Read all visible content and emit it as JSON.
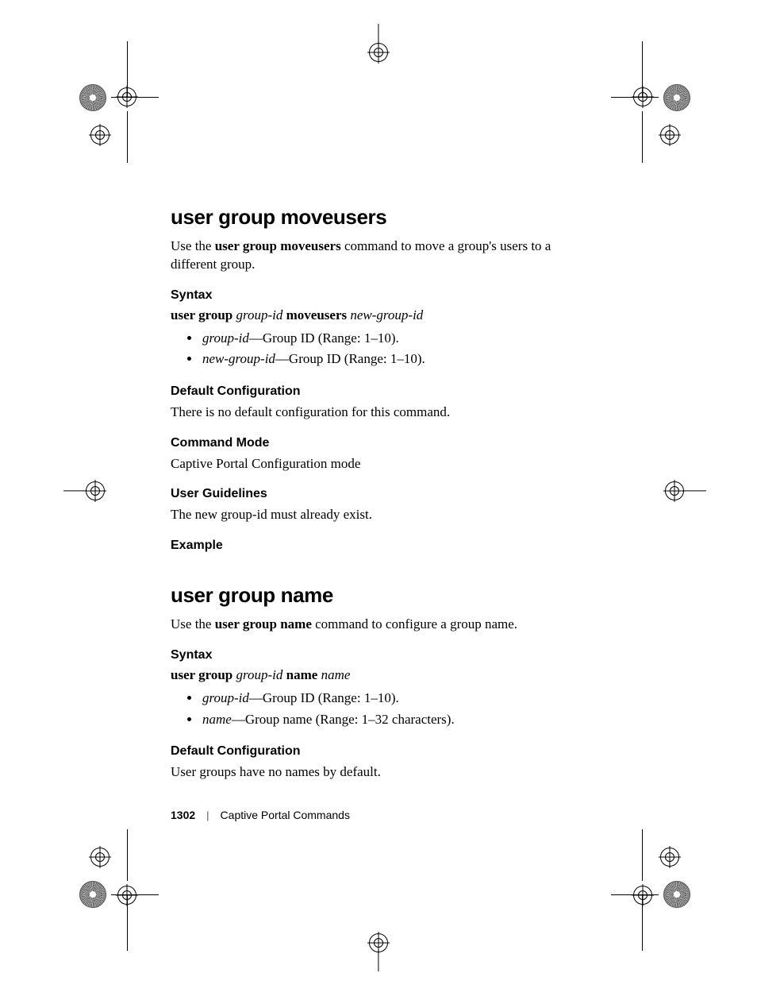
{
  "section1": {
    "title": "user group moveusers",
    "intro_pre": "Use the ",
    "intro_bold": "user group moveusers",
    "intro_post": " command to move a group's users to a different group.",
    "syntax_heading": "Syntax",
    "syntax_parts": {
      "p1": "user group ",
      "p2": "group-id",
      "p3": " moveusers ",
      "p4": "new-group-id"
    },
    "params": [
      {
        "name": "group-id",
        "desc": "—Group ID (Range: 1–10)."
      },
      {
        "name": "new-group-id",
        "desc": "—Group ID (Range: 1–10)."
      }
    ],
    "default_heading": "Default Configuration",
    "default_text": "There is no default configuration for this command.",
    "mode_heading": "Command Mode",
    "mode_text": "Captive Portal Configuration mode",
    "guidelines_heading": "User Guidelines",
    "guidelines_text": "The new group-id must already exist.",
    "example_heading": "Example"
  },
  "section2": {
    "title": "user group name",
    "intro_pre": "Use the ",
    "intro_bold": "user group name",
    "intro_post": " command to configure a group name.",
    "syntax_heading": "Syntax",
    "syntax_parts": {
      "p1": "user group ",
      "p2": "group-id",
      "p3": " name ",
      "p4": "name"
    },
    "params": [
      {
        "name": "group-id",
        "desc": "—Group ID (Range: 1–10)."
      },
      {
        "name": "name",
        "desc": "—Group name (Range: 1–32 characters)."
      }
    ],
    "default_heading": "Default Configuration",
    "default_text": "User groups have no names by default."
  },
  "footer": {
    "page": "1302",
    "section": "Captive Portal Commands"
  }
}
